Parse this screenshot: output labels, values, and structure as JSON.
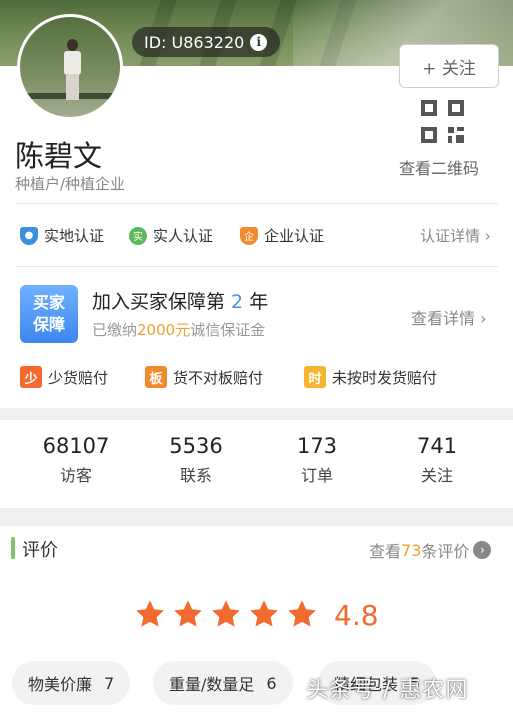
{
  "header": {
    "user_id_label": "ID: U863220",
    "info_glyph": "i",
    "follow_button": "+ 关注"
  },
  "profile": {
    "name": "陈碧文",
    "subtitle": "种植户/种植企业",
    "qr_label": "查看二维码"
  },
  "certifications": {
    "items": [
      {
        "label": "实地认证",
        "icon": "shield-location-icon",
        "color": "#3b8fe0"
      },
      {
        "label": "实人认证",
        "icon": "real-person-icon",
        "glyph": "实",
        "color": "#5cb85c"
      },
      {
        "label": "企业认证",
        "icon": "enterprise-icon",
        "glyph": "企",
        "color": "#f08a2c"
      }
    ],
    "detail_link": "认证详情 ›"
  },
  "insurance": {
    "logo_line1": "买家",
    "logo_line2": "保障",
    "title_prefix": "加入买家保障第",
    "title_years": " 2 ",
    "title_suffix": "年",
    "sub_prefix": "已缴纳",
    "sub_amount": "2000元",
    "sub_suffix": "诚信保证金",
    "detail_link": "查看详情 ›"
  },
  "guarantees": [
    {
      "glyph": "少",
      "label": "少货赔付",
      "color": "#f26a2e"
    },
    {
      "glyph": "板",
      "label": "货不对板赔付",
      "color": "#f08a2c"
    },
    {
      "glyph": "时",
      "label": "未按时发货赔付",
      "color": "#f5b530"
    }
  ],
  "stats": [
    {
      "value": "68107",
      "label": "访客"
    },
    {
      "value": "5536",
      "label": "联系"
    },
    {
      "value": "173",
      "label": "订单"
    },
    {
      "value": "741",
      "label": "关注"
    }
  ],
  "reviews": {
    "title": "评价",
    "more_prefix": "查看",
    "more_count": "73",
    "more_suffix": "条评价",
    "rating": "4.8",
    "stars": 5,
    "tags": [
      {
        "label": "物美价廉",
        "count": "7"
      },
      {
        "label": "重量/数量足",
        "count": "6"
      },
      {
        "label": "精细包装",
        "count": "5"
      }
    ]
  },
  "watermark": "头条号 / 惠农网",
  "colors": {
    "accent_orange": "#f26a2e",
    "accent_blue": "#4a90e2",
    "accent_green": "#7dc46b",
    "amount_orange": "#f0a030"
  }
}
